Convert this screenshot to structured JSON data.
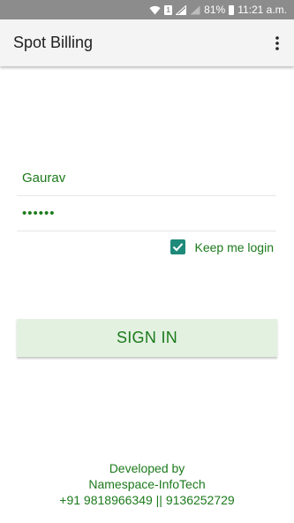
{
  "status_bar": {
    "battery": "81%",
    "time": "11:21 a.m.",
    "sim_label": "1",
    "icons": [
      "wifi-icon",
      "sim-icon",
      "signal-icon",
      "signal-icon-2",
      "battery-icon"
    ]
  },
  "app_bar": {
    "title": "Spot Billing",
    "overflow_icon": "more-vert-icon"
  },
  "login": {
    "username_value": "Gaurav",
    "password_value": "••••••",
    "keep_me_label": "Keep me login",
    "keep_me_checked": true,
    "sign_in_label": "SIGN IN"
  },
  "footer": {
    "line1": "Developed by",
    "line2": "Namespace-InfoTech",
    "line3": "+91 9818966349 || 9136252729"
  },
  "colors": {
    "accent_green": "#1c7a1c",
    "checkbox_teal": "#1e8a7a",
    "button_bg": "#e3f1e1",
    "status_bar_bg": "#8c8c8c"
  }
}
